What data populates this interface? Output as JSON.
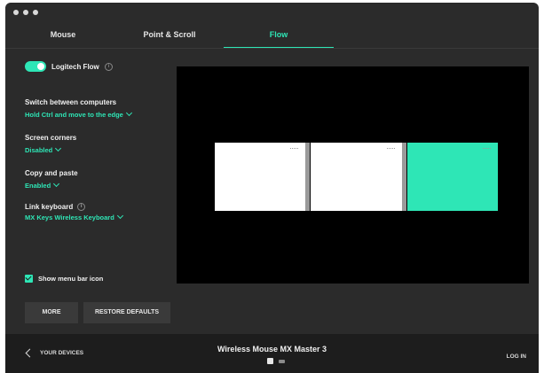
{
  "tabs": [
    {
      "label": "Mouse",
      "active": false
    },
    {
      "label": "Point & Scroll",
      "active": false
    },
    {
      "label": "Flow",
      "active": true
    }
  ],
  "flow": {
    "label": "Logitech Flow",
    "enabled": true
  },
  "settings": {
    "switch": {
      "title": "Switch between computers",
      "value": "Hold Ctrl and move to the edge"
    },
    "corners": {
      "title": "Screen corners",
      "value": "Disabled"
    },
    "copy": {
      "title": "Copy and paste",
      "value": "Enabled"
    },
    "link": {
      "title": "Link keyboard",
      "value": "MX Keys Wireless Keyboard"
    }
  },
  "menu_bar_icon": {
    "label": "Show menu bar icon",
    "checked": true
  },
  "buttons": {
    "more": "MORE",
    "restore": "RESTORE DEFAULTS"
  },
  "footer": {
    "back": "YOUR DEVICES",
    "device": "Wireless Mouse MX Master 3",
    "login": "LOG IN"
  },
  "colors": {
    "accent": "#2ee6b6",
    "background": "#2b2b2b",
    "preview": "#000000"
  },
  "icons": {
    "info": "info-icon",
    "chevron": "chevron-down-icon",
    "back": "chevron-left-icon"
  }
}
